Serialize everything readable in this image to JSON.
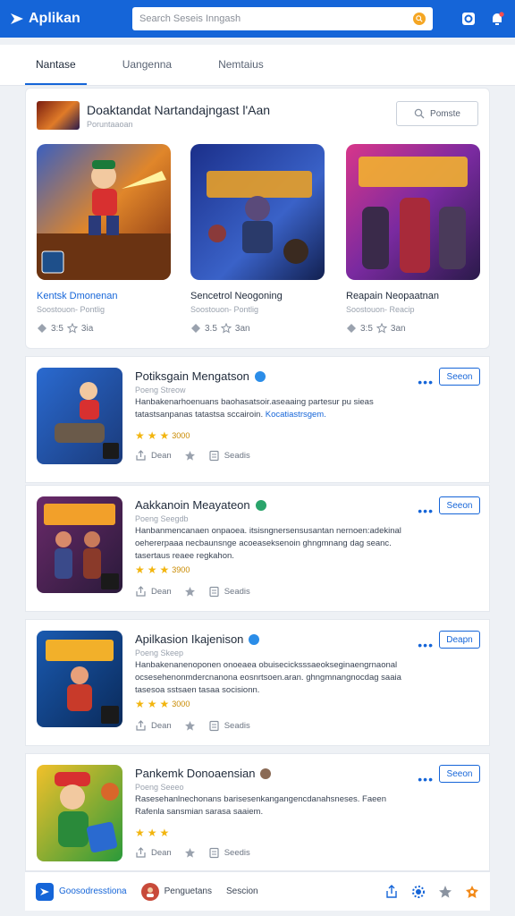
{
  "app": {
    "name": "Aplikan"
  },
  "search": {
    "placeholder": "Search Seseis Inngash"
  },
  "tabs": [
    {
      "label": "Nantase"
    },
    {
      "label": "Uangenna"
    },
    {
      "label": "Nemtaius"
    }
  ],
  "featured": {
    "title": "Doaktandat Nartandajngast l'Aan",
    "subtitle": "Poruntaaoan",
    "button_label": "Pomste",
    "games": [
      {
        "name": "Kentsk Dmonenan",
        "meta": "Soostouon- Pontlig",
        "stats": "3:5",
        "stats2": "3ia"
      },
      {
        "name": "Sencetrol Neogoning",
        "meta": "Soostouon- Pontlig",
        "stats": "3.5",
        "stats2": "3an"
      },
      {
        "name": "Reapain Neopaatnan",
        "meta": "Soostouon- Reacip",
        "stats": "3:5",
        "stats2": "3an"
      }
    ]
  },
  "apps": [
    {
      "title": "Potiksgain Mengatson",
      "subtitle": "Poeng Streow",
      "desc1": "Hanbakenarhoenuans baohasatsoir.aseaaing partesur pu sieas",
      "desc2": "tatastsanpanas tatastsa sccairoin.",
      "link": "Kocatiastrsgem.",
      "rating": "3000",
      "action1": "Dean",
      "action2": "Seadis",
      "more": "•••",
      "button": "Seeon",
      "verified_color": "#2b8de8"
    },
    {
      "title": "Aakkanoin Meayateon",
      "subtitle": "Poeng Seegdb",
      "desc1": "Hanbanmencanaen onpaoea. itsisngnersensusantan nernoen:adekinal",
      "desc2": "oehererpaaa necbaunsnge acoeaseksenoin ghngmnang dag seanc.",
      "link": "tasertaus reaee regkahon.",
      "rating": "3900",
      "action1": "Dean",
      "action2": "Seadis",
      "more": "•••",
      "button": "Seeon",
      "verified_color": "#2aa46b"
    },
    {
      "title": "Apilkasion Ikajenison",
      "subtitle": "Poeng Skeep",
      "desc1": "Hanbakenanenoponen onoeaea obuisecicksssaeokseginaengrnaonal",
      "desc2": "ocsesehenonmdercnanona eosnrtsoen.aran. ghngmnangnocdag saaia",
      "link": "tasesoa sstsaen tasaa socisionn.",
      "rating": "3000",
      "action1": "Dean",
      "action2": "Seadis",
      "more": "•••",
      "button": "Deapn",
      "verified_color": "#2b8de8"
    },
    {
      "title": "Pankemk Donoaensian",
      "subtitle": "Poeng Seeeo",
      "desc1": "Rasesehanlnechonans barisesenkangangencdanahsneses. Faeen",
      "desc2": "Rafenla sansmian sarasa saaiem.",
      "link": "",
      "rating": "",
      "action1": "Dean",
      "action2": "Seedis",
      "more": "•••",
      "button": "Seeon",
      "verified_color": "#8a6a55"
    }
  ],
  "bottom": {
    "item1": "Goosodresstiona",
    "item2": "Penguetans",
    "item3": "Sescion"
  }
}
